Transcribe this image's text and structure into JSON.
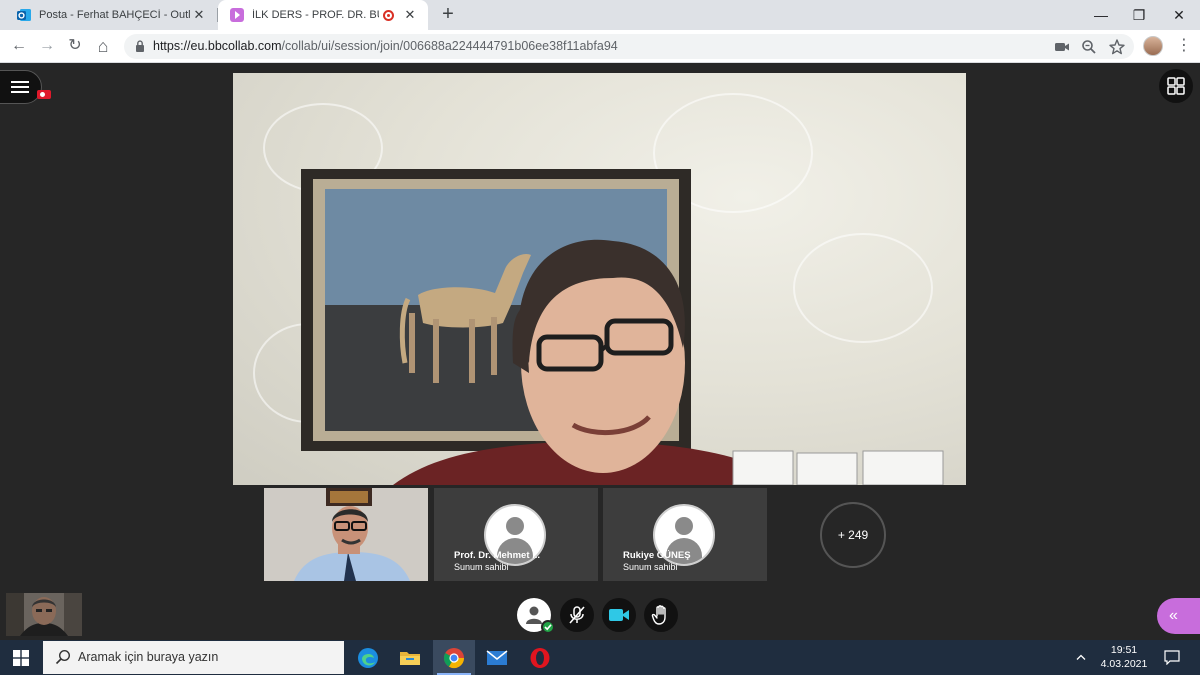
{
  "browser": {
    "tabs": [
      {
        "title": "Posta - Ferhat BAHÇECİ - Outlook",
        "active": false
      },
      {
        "title": "İLK DERS - PROF. DR. BURHAN",
        "active": true
      }
    ],
    "close_glyph": "✕",
    "new_tab_glyph": "+",
    "window_controls": {
      "minimize": "—",
      "restore": "❐",
      "close": "✕"
    },
    "nav": {
      "back": "←",
      "forward": "→",
      "reload": "↻",
      "home": "⌂"
    },
    "url_host": "https://eu.bbcollab.com",
    "url_path": "/collab/ui/session/join/006688a224444791b06ee38f11abfa94",
    "omnibox_icons": [
      "camera-icon",
      "zoom-icon",
      "star-icon"
    ]
  },
  "session": {
    "participants": [
      {
        "name": "",
        "role": "",
        "type": "video"
      },
      {
        "name": "Prof. Dr. Mehmet ...",
        "role": "Sunum sahibi",
        "type": "avatar"
      },
      {
        "name": "Rukiye GÜNEŞ",
        "role": "Sunum sahibi",
        "type": "avatar"
      }
    ],
    "more_count": "+ 249",
    "controls": [
      "status-button",
      "microphone-button",
      "camera-button",
      "hand-raise-button"
    ],
    "panel_toggle_glyph": "«",
    "colors": {
      "accent_camera": "#2fc8e6",
      "status_green": "#21a346",
      "panel_purple": "#c86ddc",
      "record_red": "#e0192b"
    }
  },
  "taskbar": {
    "search_placeholder": "Aramak için buraya yazın",
    "apps": [
      "edge-icon",
      "file-explorer-icon",
      "chrome-icon",
      "mail-icon",
      "opera-icon"
    ],
    "tray_arrow": "^",
    "time": "19:51",
    "date": "4.03.2021"
  }
}
